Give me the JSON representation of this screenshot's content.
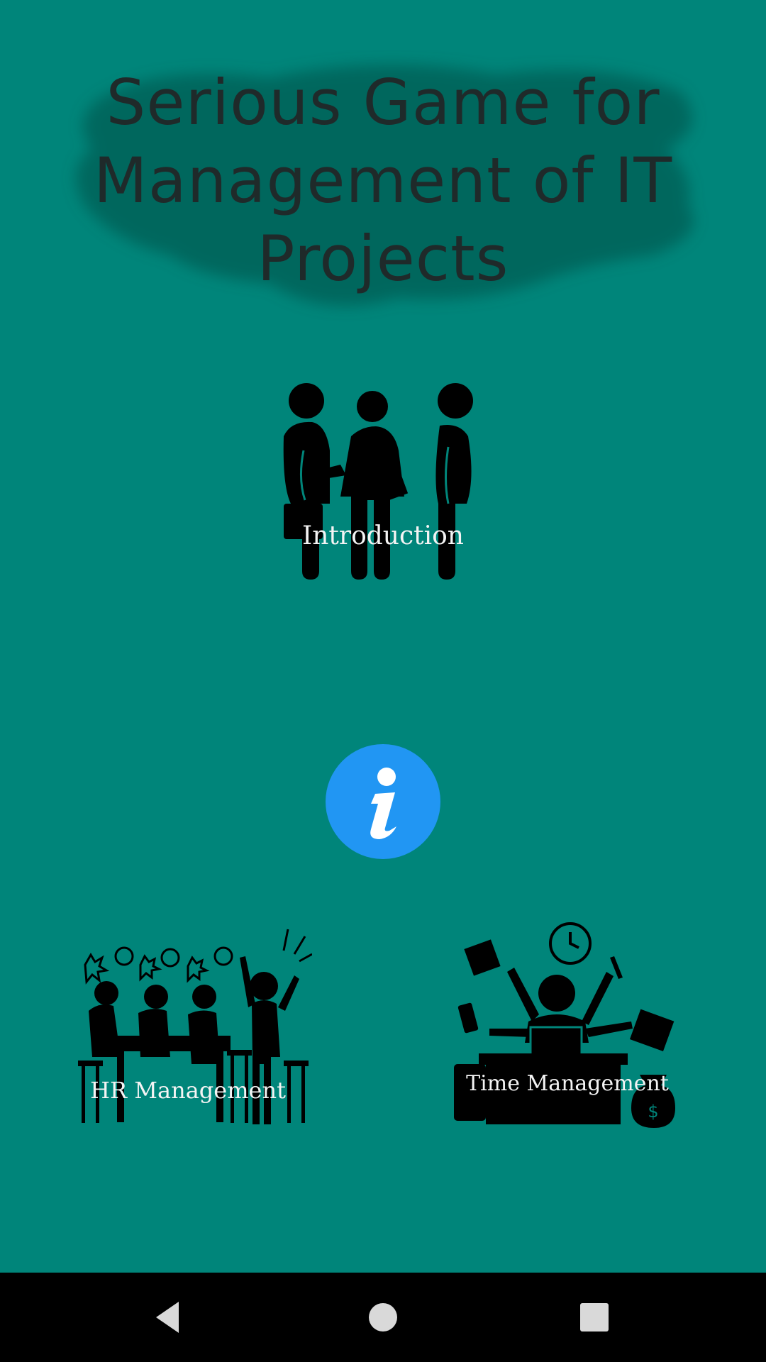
{
  "app": {
    "title": "Serious Game for Management of IT Projects"
  },
  "menu": {
    "introduction_label": "Introduction",
    "hr_label": "HR Management",
    "time_label": "Time Management",
    "info_icon": "info-icon"
  },
  "navbar": {
    "back_icon": "back-triangle-icon",
    "home_icon": "home-circle-icon",
    "recents_icon": "recents-square-icon"
  },
  "colors": {
    "background": "#00857a",
    "title_text": "#1f2a2a",
    "info_button": "#2196f3",
    "navbar": "#000000",
    "nav_icon": "#d9d9d9",
    "label_text": "#f4f4f4"
  }
}
